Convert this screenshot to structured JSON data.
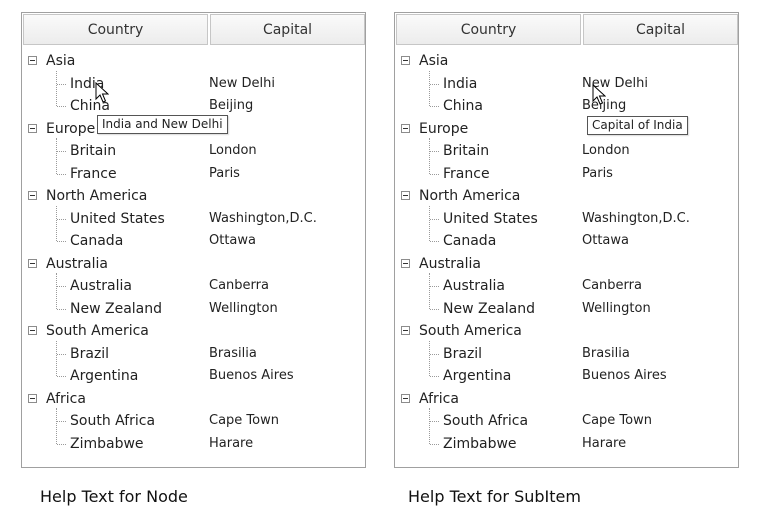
{
  "headers": {
    "country": "Country",
    "capital": "Capital"
  },
  "groups": [
    {
      "name": "Asia",
      "items": [
        {
          "country": "India",
          "capital": "New Delhi"
        },
        {
          "country": "China",
          "capital": "Beijing"
        }
      ]
    },
    {
      "name": "Europe",
      "items": [
        {
          "country": "Britain",
          "capital": "London"
        },
        {
          "country": "France",
          "capital": "Paris"
        }
      ]
    },
    {
      "name": "North America",
      "items": [
        {
          "country": "United States",
          "capital": "Washington,D.C."
        },
        {
          "country": "Canada",
          "capital": "Ottawa"
        }
      ]
    },
    {
      "name": "Australia",
      "items": [
        {
          "country": "Australia",
          "capital": "Canberra"
        },
        {
          "country": "New Zealand",
          "capital": "Wellington"
        }
      ]
    },
    {
      "name": "South America",
      "items": [
        {
          "country": "Brazil",
          "capital": "Brasilia"
        },
        {
          "country": "Argentina",
          "capital": "Buenos Aires"
        }
      ]
    },
    {
      "name": "Africa",
      "items": [
        {
          "country": "South Africa",
          "capital": "Cape Town"
        },
        {
          "country": "Zimbabwe",
          "capital": "Harare"
        }
      ]
    }
  ],
  "tooltips": {
    "node": "India and New Delhi",
    "subitem": "Capital of India"
  },
  "captions": {
    "left": "Help Text for Node",
    "right": "Help Text for SubItem"
  },
  "icons": {
    "expander": "collapse-minus-icon",
    "cursor": "mouse-pointer-icon"
  },
  "colors": {
    "border": "#a0a0a0",
    "header_bg": "#f0f0f0",
    "text": "#222222"
  }
}
